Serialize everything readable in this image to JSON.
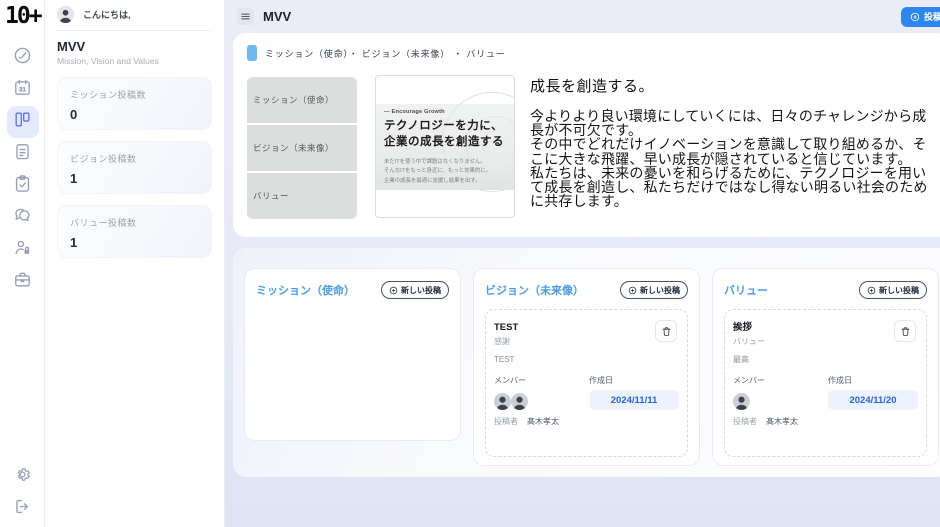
{
  "sidebar": {
    "logo": "10+"
  },
  "profile": {
    "greeting": "こんにちは,",
    "title": "MVV",
    "subtitle": "Mission, Vision and Values",
    "stats": [
      {
        "label": "ミッション投稿数",
        "value": "0"
      },
      {
        "label": "ビジョン投稿数",
        "value": "1"
      },
      {
        "label": "バリュー投稿数",
        "value": "1"
      }
    ]
  },
  "topbar": {
    "title": "MVV",
    "post_button": "投稿"
  },
  "overview": {
    "breadcrumb": "ミッション（使命）・ ビジョン（未来像） ・ バリュー",
    "categories": [
      "ミッション（使命）",
      "ビジョン（未来像）",
      "バリュー"
    ],
    "poster": {
      "tagline": "— Encourage Growth",
      "headline_line1": "テクノロジーを力に、",
      "headline_line2": "企業の成長を創造する",
      "sub_text": "未だITを使う中で課題はなくなりません。\nそんなITをもっと身近に、もっと効果的に。\n企業の成長を最適に支援し結果を出す。"
    },
    "heading": "成長を創造する。",
    "body": "今よりより良い環境にしていくには、日々のチャレンジから成長が不可欠です。\nその中でどれだけイノベーションを意識して取り組めるか、そこに大きな飛躍、早い成長が隠されていると信じています。\n私たちは、未来の憂いを和らげるために、テクノロジーを用いて成長を創造し、私たちだけではなし得ない明るい社会のために共存します。"
  },
  "sections": [
    {
      "title": "ミッション（使命）",
      "new_post_label": "新しい投稿"
    },
    {
      "title": "ビジョン（未来像）",
      "new_post_label": "新しい投稿",
      "post": {
        "title": "TEST",
        "category": "感謝",
        "body": "TEST",
        "members_label": "メンバー",
        "created_label": "作成日",
        "created_date": "2024/11/11",
        "author_label": "投稿者",
        "author": "髙木孝太"
      }
    },
    {
      "title": "バリュー",
      "new_post_label": "新しい投稿",
      "post": {
        "title": "挨拶",
        "category": "バリュー",
        "body": "最高",
        "members_label": "メンバー",
        "created_label": "作成日",
        "created_date": "2024/11/20",
        "author_label": "投稿者",
        "author": "髙木孝太"
      }
    }
  ]
}
